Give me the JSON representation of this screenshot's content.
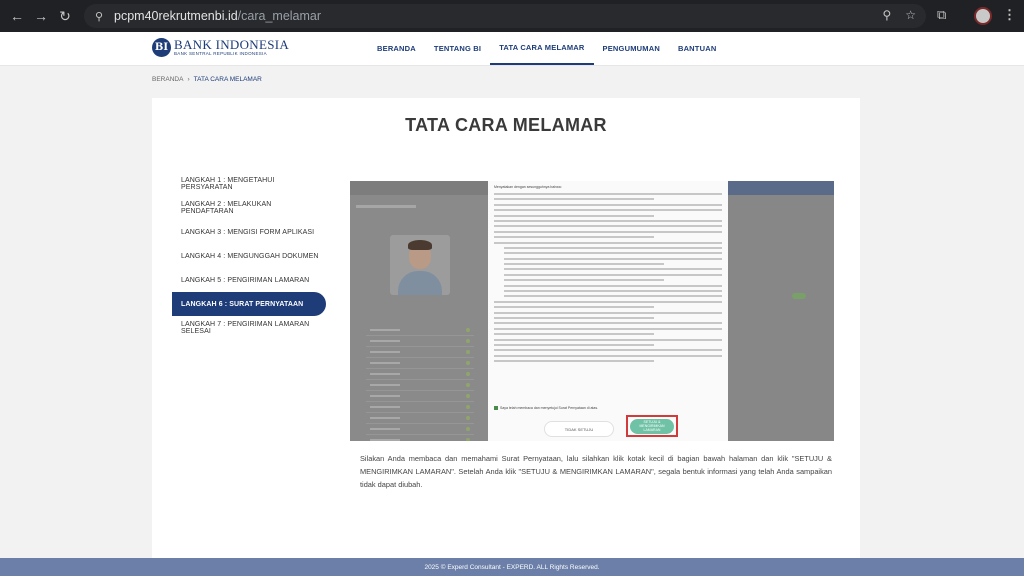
{
  "browser": {
    "url_domain": "pcpm40rekrutmenbi.id",
    "url_path": "/cara_melamar",
    "back_icon": "←",
    "forward_icon": "→",
    "reload_icon": "↻",
    "site_info_icon": "⚲",
    "zoom_icon": "⚲",
    "bookmark_icon": "☆",
    "extension_icon": "⧉",
    "menu_icon": "⋮"
  },
  "header": {
    "logo_name": "BANK INDONESIA",
    "logo_sub": "BANK SENTRAL REPUBLIK INDONESIA",
    "logo_mark": "BI",
    "nav": [
      "BERANDA",
      "TENTANG BI",
      "TATA CARA MELAMAR",
      "PENGUMUMAN",
      "BANTUAN"
    ],
    "active_index": 2
  },
  "breadcrumb": {
    "home": "BERANDA",
    "separator": "›",
    "current": "TATA CARA MELAMAR"
  },
  "page": {
    "title": "TATA CARA MELAMAR"
  },
  "steps": [
    "LANGKAH 1 : MENGETAHUI PERSYARATAN",
    "LANGKAH 2 : MELAKUKAN PENDAFTARAN",
    "LANGKAH 3 : MENGISI FORM APLIKASI",
    "LANGKAH 4 : MENGUNGGAH DOKUMEN",
    "LANGKAH 5 : PENGIRIMAN LAMARAN",
    "LANGKAH 6 : SURAT PERNYATAAN",
    "LANGKAH 7 : PENGIRIMAN LAMARAN SELESAI"
  ],
  "active_step": 5,
  "screenshot": {
    "intro": "Menyatakan dengan sesungguhnya bahwa:",
    "checkbox_label": "Saya telah membaca dan menyetujui Surat Pernyataan di atas.",
    "disagree_label": "TIDAK SETUJU",
    "agree_label": "SETUJU & MENGIRIMKAN LAMARAN",
    "highlight_color": "#d13b3b"
  },
  "description": "Silakan Anda membaca dan memahami Surat Pernyataan, lalu silahkan klik kotak kecil di bagian bawah halaman dan klik \"SETUJU & MENGIRIMKAN LAMARAN\". Setelah Anda klik \"SETUJU & MENGIRIMKAN LAMARAN\", segala bentuk informasi yang telah Anda sampaikan tidak dapat diubah.",
  "footer": "2025 © Experd Consultant - EXPERD. ALL Rights Reserved."
}
